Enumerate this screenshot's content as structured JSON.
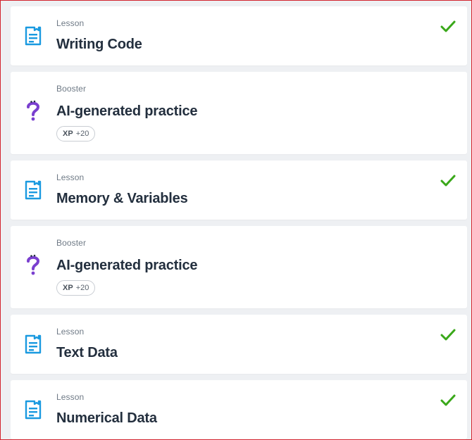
{
  "items": [
    {
      "type": "Lesson",
      "title": "Writing Code",
      "completed": true,
      "icon": "document-icon"
    },
    {
      "type": "Booster",
      "title": "AI-generated practice",
      "xp_label": "XP",
      "xp_value": "+20",
      "icon": "question-mark-icon"
    },
    {
      "type": "Lesson",
      "title": "Memory & Variables",
      "completed": true,
      "icon": "document-icon"
    },
    {
      "type": "Booster",
      "title": "AI-generated practice",
      "xp_label": "XP",
      "xp_value": "+20",
      "icon": "question-mark-icon"
    },
    {
      "type": "Lesson",
      "title": "Text Data",
      "completed": true,
      "icon": "document-icon"
    },
    {
      "type": "Lesson",
      "title": "Numerical Data",
      "completed": true,
      "icon": "document-icon"
    }
  ],
  "colors": {
    "lesson_icon": "#1a9ae0",
    "booster_icon": "#7a3fcf",
    "check": "#3aa81a",
    "title": "#232f3e",
    "type_label": "#6f7a86",
    "frame_border": "#d3242f"
  }
}
